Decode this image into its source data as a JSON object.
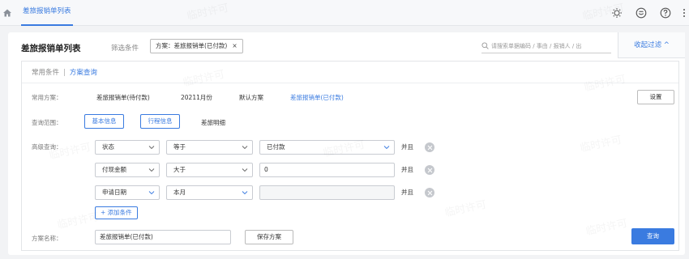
{
  "topbar": {
    "tab_label": "差旅报销单列表",
    "icons": [
      "home-icon",
      "bulb-icon",
      "smile-icon",
      "help-icon"
    ]
  },
  "header": {
    "title": "差旅报销单列表",
    "filter_label": "筛选条件",
    "filter_chip": "方案：差旅报销单(已付款)",
    "chip_close": "×",
    "search_placeholder": "请搜索单据编码 / 事由 / 报销人 / 出",
    "collapse_label": "收起过滤 ^"
  },
  "condition_tabs": {
    "common": "常用条件",
    "separator": "|",
    "scheme_query": "方案查询"
  },
  "common_schemes": {
    "label": "常用方案：",
    "items": [
      "差旅报销单(待付款)",
      "20211月份",
      "默认方案",
      "差旅报销单(已付款)"
    ],
    "active_index": 3,
    "settings_label": "设置"
  },
  "query_scope": {
    "label": "查询范围：",
    "items": [
      "基本信息",
      "行程信息",
      "差旅明细"
    ]
  },
  "advanced_query": {
    "label": "高级查询：",
    "conjunction": "并且",
    "rows": [
      {
        "field": "状态",
        "operator": "等于",
        "value": "已付款"
      },
      {
        "field": "付现金额",
        "operator": "大于",
        "value": "0"
      },
      {
        "field": "申请日期",
        "operator": "本月",
        "value": ""
      }
    ],
    "add_label": "+ 添加条件"
  },
  "footer": {
    "scheme_name_label": "方案名称：",
    "scheme_name_value": "差旅报销单(已付款)",
    "save_label": "保存方案",
    "query_label": "查询"
  },
  "watermark": "临时许可",
  "colors": {
    "accent": "#3a7be0",
    "border": "#c9ccd2",
    "background": "#f2f3f5"
  }
}
